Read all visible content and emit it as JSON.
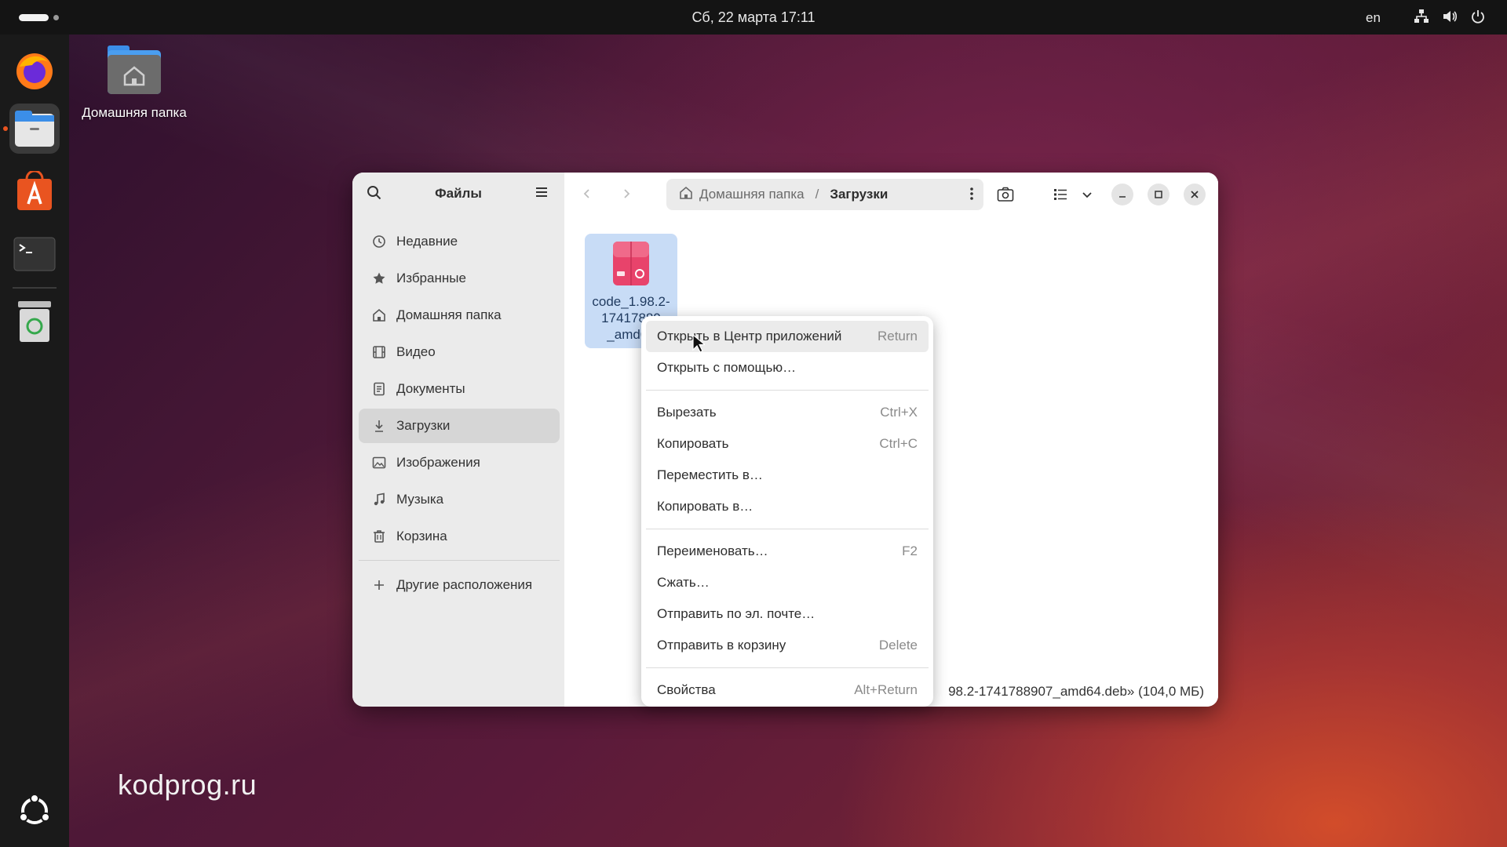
{
  "topbar": {
    "clock": "Сб, 22 марта  17:11",
    "language": "en",
    "icons": [
      "network-icon",
      "volume-icon",
      "power-icon"
    ]
  },
  "dock": {
    "items": [
      {
        "name": "firefox-icon"
      },
      {
        "name": "files-icon",
        "active": true
      },
      {
        "name": "app-center-icon"
      },
      {
        "name": "terminal-icon"
      },
      {
        "name": "trash-icon"
      }
    ],
    "show_apps_icon": "ubuntu-apps-icon"
  },
  "desktop": {
    "home_folder_label": "Домашняя папка",
    "watermark": "kodprog.ru"
  },
  "window": {
    "sidebar": {
      "title": "Файлы",
      "items": [
        {
          "label": "Недавние",
          "icon": "clock-icon"
        },
        {
          "label": "Избранные",
          "icon": "star-icon"
        },
        {
          "label": "Домашняя папка",
          "icon": "home-icon"
        },
        {
          "label": "Видео",
          "icon": "video-icon"
        },
        {
          "label": "Документы",
          "icon": "document-icon"
        },
        {
          "label": "Загрузки",
          "icon": "download-icon",
          "active": true
        },
        {
          "label": "Изображения",
          "icon": "image-icon"
        },
        {
          "label": "Музыка",
          "icon": "music-icon"
        },
        {
          "label": "Корзина",
          "icon": "trash-icon"
        }
      ],
      "other_locations": "Другие расположения"
    },
    "pathbar": {
      "home": "Домашняя папка",
      "separator": "/",
      "current": "Загрузки"
    },
    "file": {
      "name_line1": "code_1.98.2-",
      "name_line2": "17417889",
      "name_line3": "_amd64"
    },
    "status_text": "98.2-1741788907_amd64.deb» (104,0 МБ)"
  },
  "context_menu": {
    "groups": [
      [
        {
          "label": "Открыть в Центр приложений",
          "accel": "Return",
          "hover": true
        },
        {
          "label": "Открыть с помощью…",
          "accel": ""
        }
      ],
      [
        {
          "label": "Вырезать",
          "accel": "Ctrl+X"
        },
        {
          "label": "Копировать",
          "accel": "Ctrl+C"
        },
        {
          "label": "Переместить в…",
          "accel": ""
        },
        {
          "label": "Копировать в…",
          "accel": ""
        }
      ],
      [
        {
          "label": "Переименовать…",
          "accel": "F2"
        },
        {
          "label": "Сжать…",
          "accel": ""
        },
        {
          "label": "Отправить по эл. почте…",
          "accel": ""
        },
        {
          "label": "Отправить в корзину",
          "accel": "Delete"
        }
      ],
      [
        {
          "label": "Свойства",
          "accel": "Alt+Return"
        }
      ]
    ]
  },
  "colors": {
    "accent": "#e95420",
    "selection": "#c8dcf6",
    "deb_icon": "#e8436b"
  }
}
